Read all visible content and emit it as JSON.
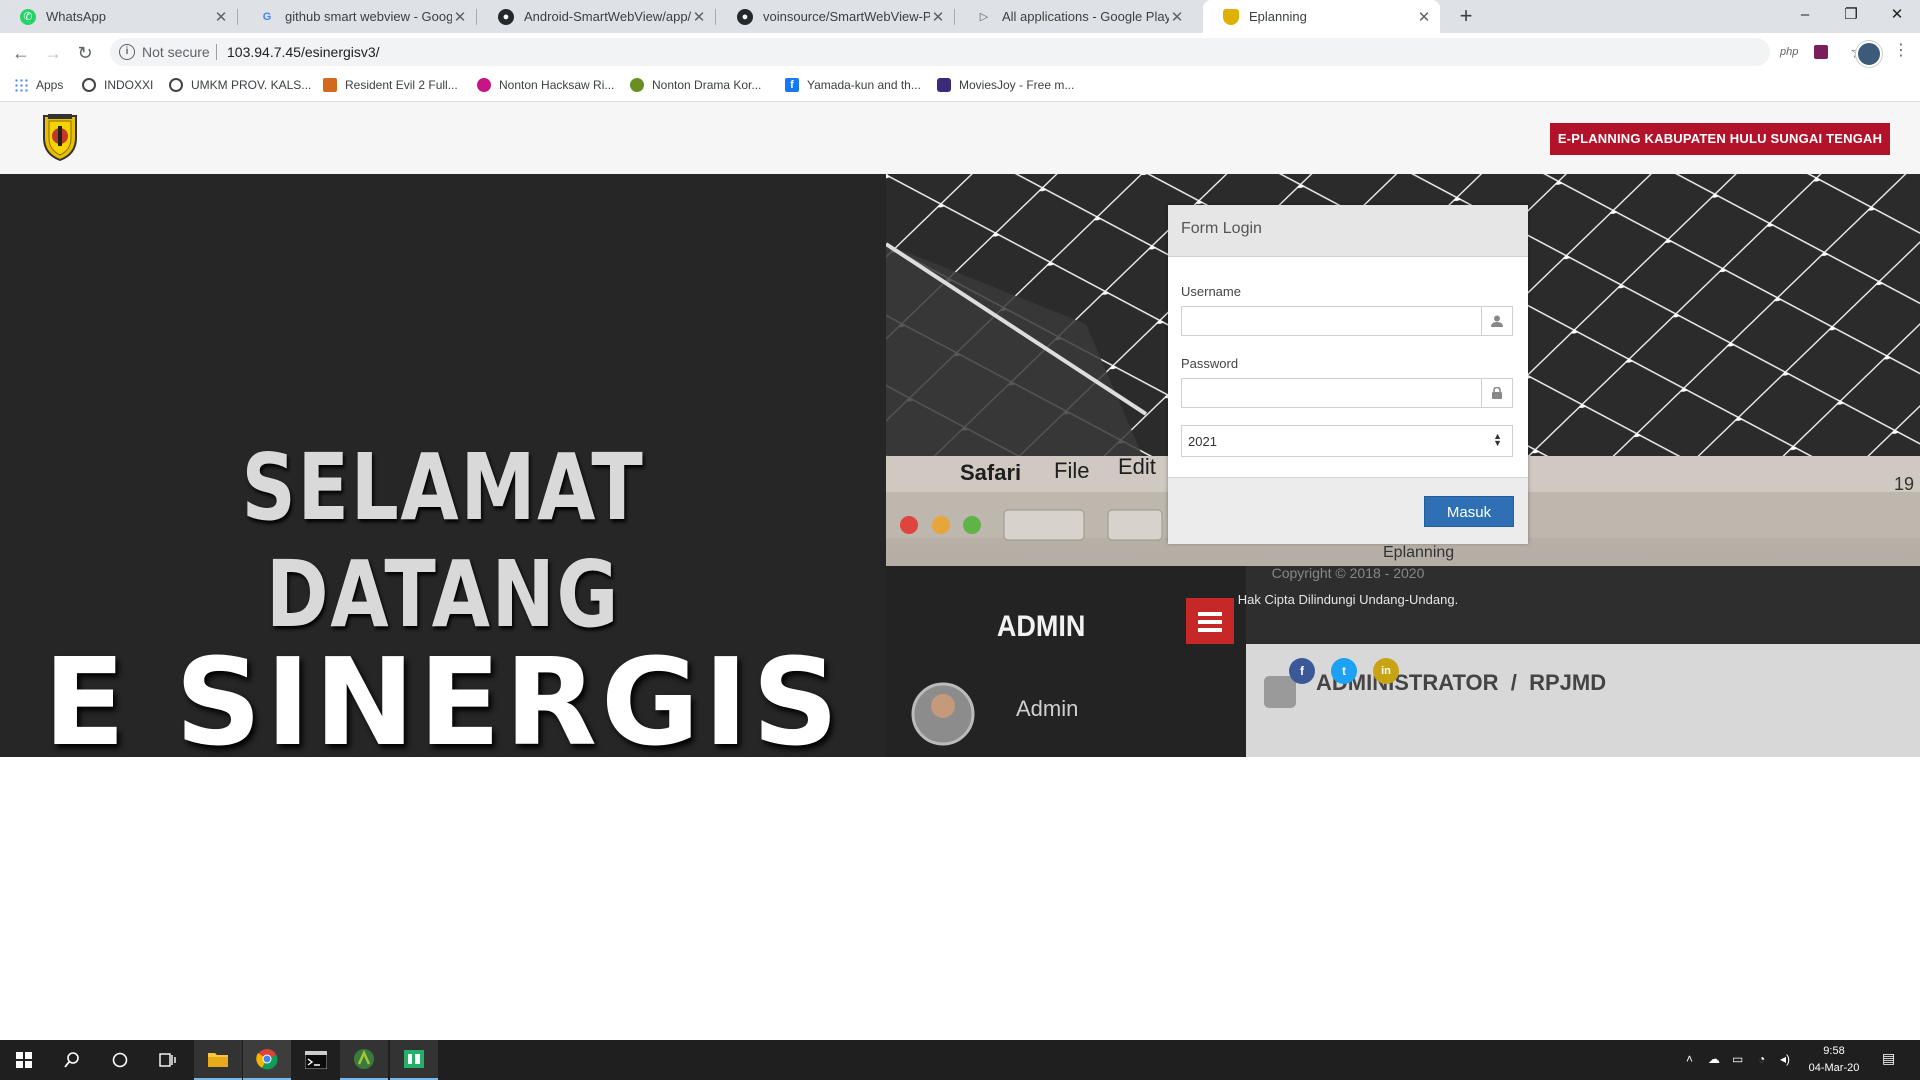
{
  "browser": {
    "tabs": [
      {
        "title": "WhatsApp",
        "icon": "whatsapp-icon",
        "color": "#25d366"
      },
      {
        "title": "github smart webview - Google S",
        "icon": "google-icon",
        "color": "#4285f4"
      },
      {
        "title": "Android-SmartWebView/app/src",
        "icon": "github-icon",
        "color": "#24292e"
      },
      {
        "title": "voinsource/SmartWebView-Pro:",
        "icon": "github-icon",
        "color": "#24292e"
      },
      {
        "title": "All applications - Google Play Co",
        "icon": "google-play-icon",
        "color": "#5f6368"
      },
      {
        "title": "Eplanning",
        "icon": "eplanning-shield-icon",
        "color": "#e0b000"
      }
    ],
    "active_tab": 5,
    "not_secure": "Not secure",
    "url": "103.94.7.45/esinergisv3/",
    "ext_php": "php",
    "bookmarks": [
      {
        "label": "Apps",
        "color": "#4285f4"
      },
      {
        "label": "INDOXXI",
        "color": "#444444"
      },
      {
        "label": "UMKM PROV. KALS...",
        "color": "#444444"
      },
      {
        "label": "Resident Evil 2 Full...",
        "color": "#d2691e"
      },
      {
        "label": "Nonton Hacksaw Ri...",
        "color": "#c71585"
      },
      {
        "label": "Nonton Drama Kor...",
        "color": "#6b8e23"
      },
      {
        "label": "Yamada-kun and th...",
        "color": "#1877f2"
      },
      {
        "label": "MoviesJoy - Free m...",
        "color": "#3b2a7a"
      }
    ]
  },
  "page": {
    "brand_button": "E-PLANNING KABUPATEN HULU SUNGAI TENGAH",
    "hero_line1": "SELAMAT DATANG",
    "hero_line2": "E SINERGIS",
    "photo_texts": {
      "safari": "Safari",
      "file": "File",
      "edit": "Edit",
      "admin_header": "ADMIN",
      "admin_user": "Admin",
      "breadcrumb": "ADMINISTRATOR  /  RPJMD",
      "corner": "19",
      "eplanning": "Eplanning"
    },
    "login": {
      "title": "Form Login",
      "username_label": "Username",
      "password_label": "Password",
      "year_value": "2021",
      "submit": "Masuk"
    },
    "copyright": "Copyright © 2018 - 2020",
    "rights": "Hak Cipta Dilindungi Undang-Undang.",
    "social": [
      {
        "icon": "facebook-icon",
        "glyph": "f",
        "color": "#3b5998"
      },
      {
        "icon": "twitter-icon",
        "glyph": "t",
        "color": "#1da1f2"
      },
      {
        "icon": "linkedin-icon",
        "glyph": "in",
        "color": "#c8a415"
      }
    ],
    "colors": {
      "brand_red": "#b3132a",
      "button_blue": "#2f6fb3"
    }
  },
  "taskbar": {
    "time": "9:58",
    "date": "04-Mar-20"
  }
}
